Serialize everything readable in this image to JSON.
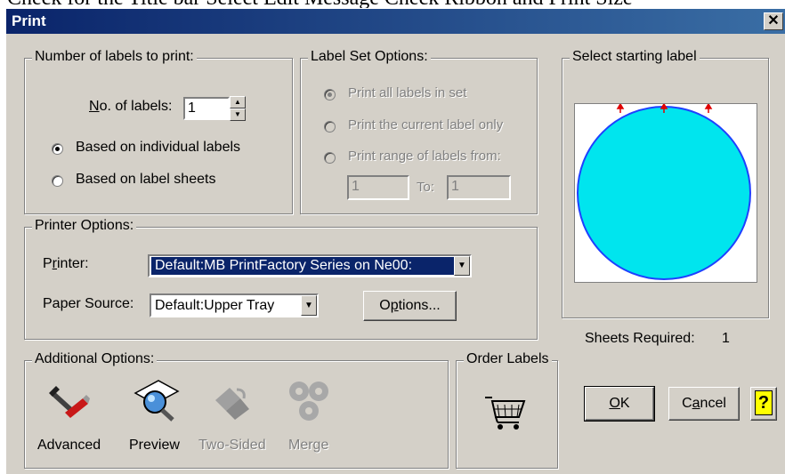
{
  "document_text": "Check for the Title bar Select Edit Message Check Ribbon and Print Size",
  "dialog": {
    "title": "Print",
    "close_glyph": "✕"
  },
  "number_of_labels": {
    "group_label": "Number of labels to print:",
    "no_labels_label": "No. of labels:",
    "no_labels_value": "1",
    "option_individual": "Based on individual labels",
    "option_sheets": "Based on label sheets",
    "selected": "individual"
  },
  "label_set_options": {
    "group_label": "Label Set Options:",
    "option_all": "Print all labels in set",
    "option_current": "Print the current label only",
    "option_range": "Print range of labels from:",
    "range_from": "1",
    "range_to_label": "To:",
    "range_to": "1"
  },
  "select_starting_label": {
    "group_label": "Select starting label",
    "circle_color": "#00e5ee"
  },
  "printer_options": {
    "group_label": "Printer Options:",
    "printer_label": "Printer:",
    "printer_value": "Default:MB PrintFactory Series on Ne00:",
    "paper_source_label": "Paper Source:",
    "paper_source_value": "Default:Upper Tray",
    "options_button": "Options..."
  },
  "sheets_required": {
    "label": "Sheets Required:",
    "value": "1"
  },
  "additional_options": {
    "group_label": "Additional Options:",
    "items": [
      {
        "label": "Advanced",
        "icon": "tools-icon",
        "enabled": true
      },
      {
        "label": "Preview",
        "icon": "magnifier-icon",
        "enabled": true
      },
      {
        "label": "Two-Sided",
        "icon": "two-sided-icon",
        "enabled": false
      },
      {
        "label": "Merge",
        "icon": "merge-icon",
        "enabled": false
      }
    ]
  },
  "order_labels": {
    "group_label": "Order Labels",
    "icon": "shopping-cart-icon"
  },
  "buttons": {
    "ok": "OK",
    "cancel": "Cancel",
    "help_icon": "?"
  },
  "colors": {
    "titlebar": "#0a246a",
    "dialog_bg": "#d4d0c8",
    "selection": "#0a246a"
  }
}
